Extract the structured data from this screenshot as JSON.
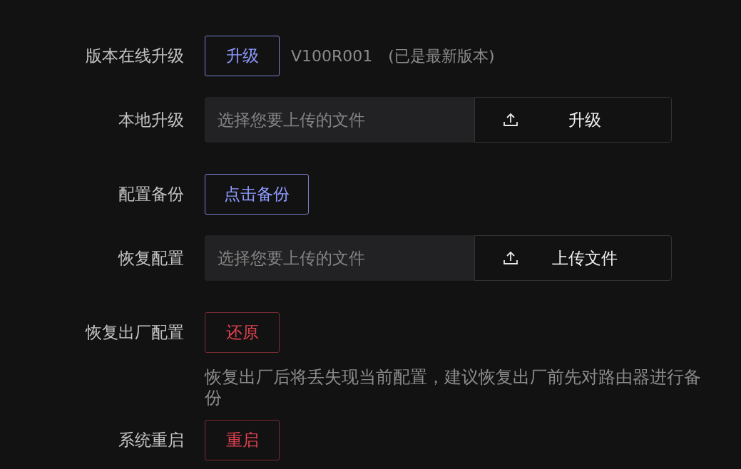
{
  "rows": [
    {
      "kind": "button",
      "label": "版本在线升级",
      "button": {
        "text": "升级",
        "kind": "primary"
      },
      "info": [
        "V100R001",
        "(已是最新版本)"
      ]
    },
    {
      "kind": "file",
      "label": "本地升级",
      "placeholder": "选择您要上传的文件",
      "button": {
        "text": "升级"
      }
    },
    {
      "kind": "button",
      "label": "配置备份",
      "button": {
        "text": "点击备份",
        "kind": "primary"
      }
    },
    {
      "kind": "file",
      "label": "恢复配置",
      "placeholder": "选择您要上传的文件",
      "button": {
        "text": "上传文件"
      }
    },
    {
      "kind": "button",
      "label": "恢复出厂配置",
      "button": {
        "text": "还原",
        "kind": "danger"
      },
      "note": "恢复出厂后将丢失现当前配置，建议恢复出厂前先对路由器进行备份"
    },
    {
      "kind": "button",
      "label": "系统重启",
      "button": {
        "text": "重启",
        "kind": "danger"
      }
    }
  ]
}
